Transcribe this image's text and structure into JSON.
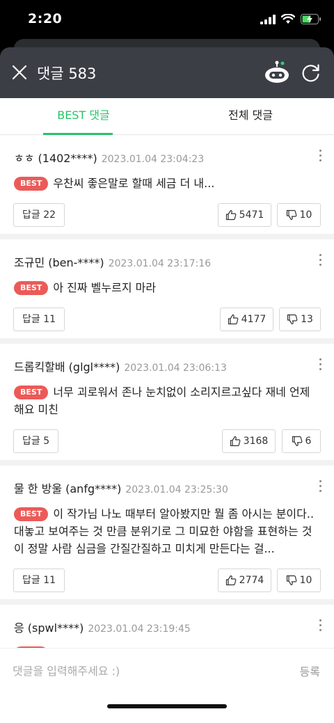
{
  "status_bar": {
    "time": "2:20"
  },
  "header": {
    "title": "댓글 583"
  },
  "tabs": [
    {
      "label": "BEST 댓글",
      "active": true
    },
    {
      "label": "전체 댓글",
      "active": false
    }
  ],
  "best_badge": "BEST",
  "comments": [
    {
      "author": "ㅎㅎ (1402****)",
      "date": "2023.01.04 23:04:23",
      "text": "우찬씨 좋은말로 할때 세금 더 내...",
      "reply": "답글 22",
      "likes": "5471",
      "dislikes": "10"
    },
    {
      "author": "조규민 (ben-****)",
      "date": "2023.01.04 23:17:16",
      "text": "아 진짜 벨누르지 마라",
      "reply": "답글 11",
      "likes": "4177",
      "dislikes": "13"
    },
    {
      "author": "드롭킥할배 (glgl****)",
      "date": "2023.01.04 23:06:13",
      "text": "너무 괴로워서 존나 눈치없이 소리지르고싶다 재네 언제해요 미친",
      "reply": "답글 5",
      "likes": "3168",
      "dislikes": "6"
    },
    {
      "author": "물 한 방울 (anfg****)",
      "date": "2023.01.04 23:25:30",
      "text": "이 작가님 나노 때부터 알아봤지만 뭘 좀 아시는 분이다.. 대놓고 보여주는 것 만큼 분위기로 그 미묘한 야함을 표현하는 것이 정말 사람 심금을 간질간질하고 미치게 만든다는 걸...",
      "reply": "답글 11",
      "likes": "2774",
      "dislikes": "10"
    },
    {
      "author": "응 (spwl****)",
      "date": "2023.01.04 23:19:45"
    }
  ],
  "input": {
    "placeholder": "댓글을 입력해주세요 :)",
    "submit_label": "등록"
  }
}
